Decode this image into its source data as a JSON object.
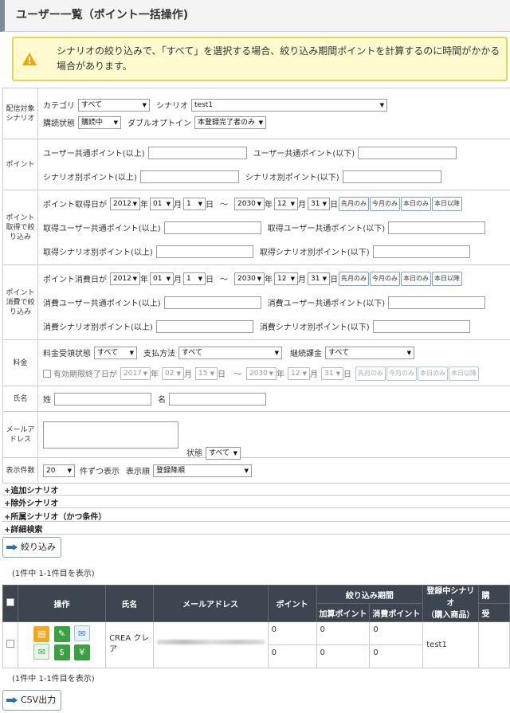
{
  "page": {
    "title": "ユーザー一覧（ポイント一括操作)"
  },
  "alert": {
    "message": "シナリオの絞り込みで、「すべて」を選択する場合、絞り込み期間ポイントを計算するのに時間がかかる場合があります。"
  },
  "filters": {
    "scenario_section": {
      "label": "配信対象シナリオ",
      "category_label": "カテゴリ",
      "category_value": "すべて",
      "scenario_label": "シナリオ",
      "scenario_value": "test1",
      "subscribe_label": "購読状態",
      "subscribe_value": "購読中",
      "double_optin_label": "ダブルオプトイン",
      "double_optin_value": "本登録完了者のみ"
    },
    "point_section": {
      "label": "ポイント",
      "common_min": "ユーザー共通ポイント(以上)",
      "common_max": "ユーザー共通ポイント(以下)",
      "scenario_min": "シナリオ別ポイント(以上)",
      "scenario_max": "シナリオ別ポイント(以下)"
    },
    "acquire_section": {
      "label": "ポイント取得で絞り込み",
      "date_label": "ポイント取得日が",
      "from": {
        "year": "2012",
        "month": "01",
        "day": "1"
      },
      "to": {
        "year": "2030",
        "month": "12",
        "day": "31"
      },
      "common_min": "取得ユーザー共通ポイント(以上)",
      "common_max": "取得ユーザー共通ポイント(以下)",
      "scenario_min": "取得シナリオ別ポイント(以上)",
      "scenario_max": "取得シナリオ別ポイント(以下)"
    },
    "consume_section": {
      "label": "ポイント消費で絞り込み",
      "date_label": "ポイント消費日が",
      "from": {
        "year": "2012",
        "month": "01",
        "day": "1"
      },
      "to": {
        "year": "2030",
        "month": "12",
        "day": "31"
      },
      "common_min": "消費ユーザー共通ポイント(以上)",
      "common_max": "消費ユーザー共通ポイント(以下)",
      "scenario_min": "消費シナリオ別ポイント(以上)",
      "scenario_max": "消費シナリオ別ポイント(以下)"
    },
    "fee_section": {
      "label": "料金",
      "status_label": "料金受領状態",
      "status_value": "すべて",
      "method_label": "支払方法",
      "method_value": "すべて",
      "continuous_label": "継続課金",
      "continuous_value": "すべて",
      "expiry_label": "有効期限終了日が",
      "from": {
        "year": "2017",
        "month": "02",
        "day": "15"
      },
      "to": {
        "year": "2030",
        "month": "12",
        "day": "31"
      }
    },
    "name_section": {
      "label": "氏名",
      "last": "姓",
      "first": "名"
    },
    "mail_section": {
      "label": "メールアドレス",
      "status_label": "状態",
      "status_value": "すべて"
    },
    "display_section": {
      "label": "表示件数",
      "count_value": "20",
      "count_suffix": "件ずつ表示",
      "order_label": "表示順",
      "order_value": "登録降順"
    },
    "units": {
      "year": "年",
      "month": "月",
      "day": "日",
      "tilde": "～"
    },
    "quick_buttons": [
      "先月のみ",
      "今月のみ",
      "本日のみ",
      "本日以降"
    ]
  },
  "toggles": [
    "+追加シナリオ",
    "+除外シナリオ",
    "+所属シナリオ（かつ条件）",
    "+詳細検索"
  ],
  "filter_button": "絞り込み",
  "count_text": "(1件中 1-1件目を表示)",
  "results": {
    "headers": {
      "actions": "操作",
      "name": "氏名",
      "email": "メールアドレス",
      "point": "ポイント",
      "period": "絞り込み期間",
      "added": "加算ポイント",
      "consumed": "消費ポイント",
      "scenario": "登録中シナリオ",
      "scenario_sub": "（購入商品）",
      "extra": "購",
      "extra_sub": "受"
    },
    "rows": [
      {
        "name": "CREA クレア",
        "point_1": "0",
        "point_2": "0",
        "added_1": "0",
        "added_2": "0",
        "consumed_1": "0",
        "consumed_2": "0",
        "scenario": "test1"
      }
    ]
  },
  "csv_button": "CSV出力",
  "colors": {
    "header_bar": "#3c4550",
    "alert_bg": "#fffbcf",
    "alert_border": "#e6d35a",
    "button_border": "#7aa6d6"
  }
}
